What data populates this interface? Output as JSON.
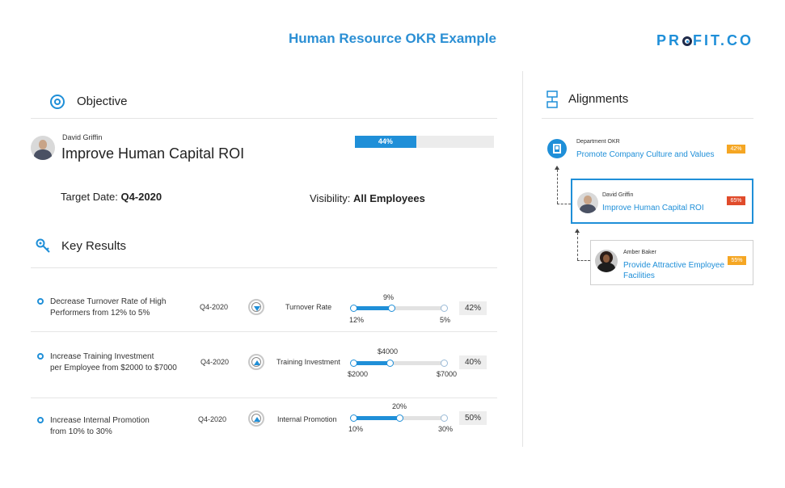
{
  "header": {
    "title": "Human Resource OKR Example",
    "logo_pre": "PR",
    "logo_post": "FIT.CO"
  },
  "objective": {
    "section_title": "Objective",
    "owner": "David Griffin",
    "title": "Improve Human Capital ROI",
    "progress_label": "44%",
    "progress": 0.44,
    "target_date_label": "Target Date:",
    "target_date": "Q4-2020",
    "visibility_label": "Visibility:",
    "visibility": "All Employees"
  },
  "key_results": {
    "section_title": "Key Results",
    "items": [
      {
        "text_line1": "Decrease Turnover Rate of High",
        "text_line2": "Performers from 12% to 5%",
        "date": "Q4-2020",
        "direction": "down",
        "metric": "Turnover Rate",
        "current": "9%",
        "start": "12%",
        "target": "5%",
        "percent": "42%",
        "progress": 0.42
      },
      {
        "text_line1": "Increase Training Investment",
        "text_line2": "per Employee from $2000 to $7000",
        "date": "Q4-2020",
        "direction": "up",
        "metric": "Training Investment",
        "current": "$4000",
        "start": "$2000",
        "target": "$7000",
        "percent": "40%",
        "progress": 0.4
      },
      {
        "text_line1": "Increase Internal Promotion",
        "text_line2": "from 10% to 30%",
        "date": "Q4-2020",
        "direction": "up",
        "metric": "Internal Promotion",
        "current": "20%",
        "start": "10%",
        "target": "30%",
        "percent": "50%",
        "progress": 0.5
      }
    ]
  },
  "alignments": {
    "section_title": "Alignments",
    "department": {
      "label": "Department OKR",
      "title": "Promote Company Culture and Values",
      "badge": "42%",
      "badge_color": "#f5a623"
    },
    "current": {
      "owner": "David Griffin",
      "title": "Improve Human Capital ROI",
      "badge": "65%",
      "badge_color": "#e04b2b"
    },
    "child": {
      "owner": "Amber Baker",
      "title_line1": "Provide Attractive Employee",
      "title_line2": "Facilities",
      "badge": "55%",
      "badge_color": "#f5a623"
    }
  },
  "colors": {
    "accent": "#1f8fd8",
    "logo_dark": "#1f2b4a"
  }
}
